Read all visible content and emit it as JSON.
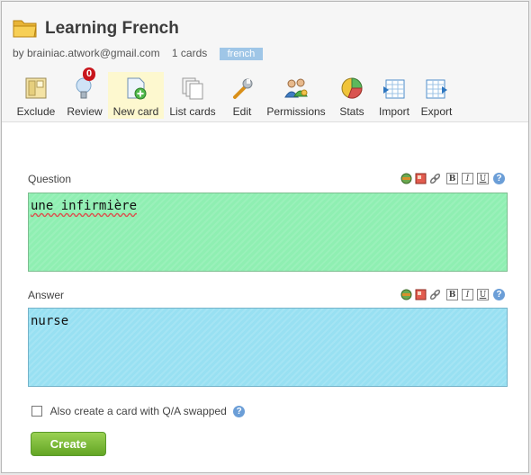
{
  "deck": {
    "title": "Learning French",
    "owner": "by brainiac.atwork@gmail.com",
    "card_count": "1 cards",
    "tag": "french"
  },
  "toolbar": {
    "items": [
      {
        "label": "Exclude",
        "icon": "exclude-icon"
      },
      {
        "label": "Review",
        "icon": "lightbulb-icon",
        "badge": "0"
      },
      {
        "label": "New card",
        "icon": "new-card-icon",
        "active": true
      },
      {
        "label": "List cards",
        "icon": "list-cards-icon"
      },
      {
        "label": "Edit",
        "icon": "wrench-icon"
      },
      {
        "label": "Permissions",
        "icon": "users-icon"
      },
      {
        "label": "Stats",
        "icon": "pie-chart-icon"
      },
      {
        "label": "Import",
        "icon": "import-icon"
      },
      {
        "label": "Export",
        "icon": "export-icon"
      }
    ]
  },
  "editor_buttons": {
    "bold": "B",
    "italic": "I",
    "underline": "U",
    "help": "?"
  },
  "question": {
    "label": "Question",
    "value": "une infirmière"
  },
  "answer": {
    "label": "Answer",
    "value": "nurse"
  },
  "swap_option": {
    "label": "Also create a card with Q/A swapped",
    "checked": false
  },
  "create_button": {
    "label": "Create"
  },
  "colors": {
    "question_bg": "#8fefb2",
    "answer_bg": "#98e0f2",
    "create_green": "#7bbd3a",
    "tag_blue": "#9fc6e7",
    "badge_red": "#c8161d"
  }
}
